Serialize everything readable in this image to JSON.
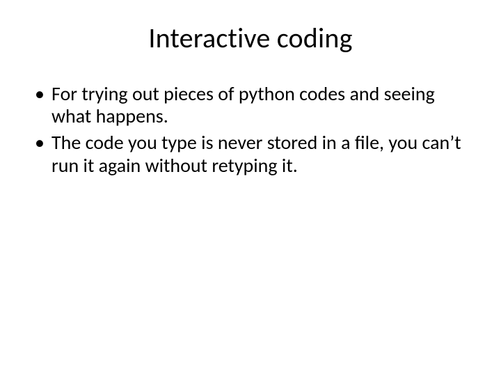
{
  "slide": {
    "title": "Interactive coding",
    "bullets": [
      "For trying out pieces of python codes and seeing what happens.",
      "The code you type is never stored in a file, you can’t run it again without retyping it."
    ]
  }
}
